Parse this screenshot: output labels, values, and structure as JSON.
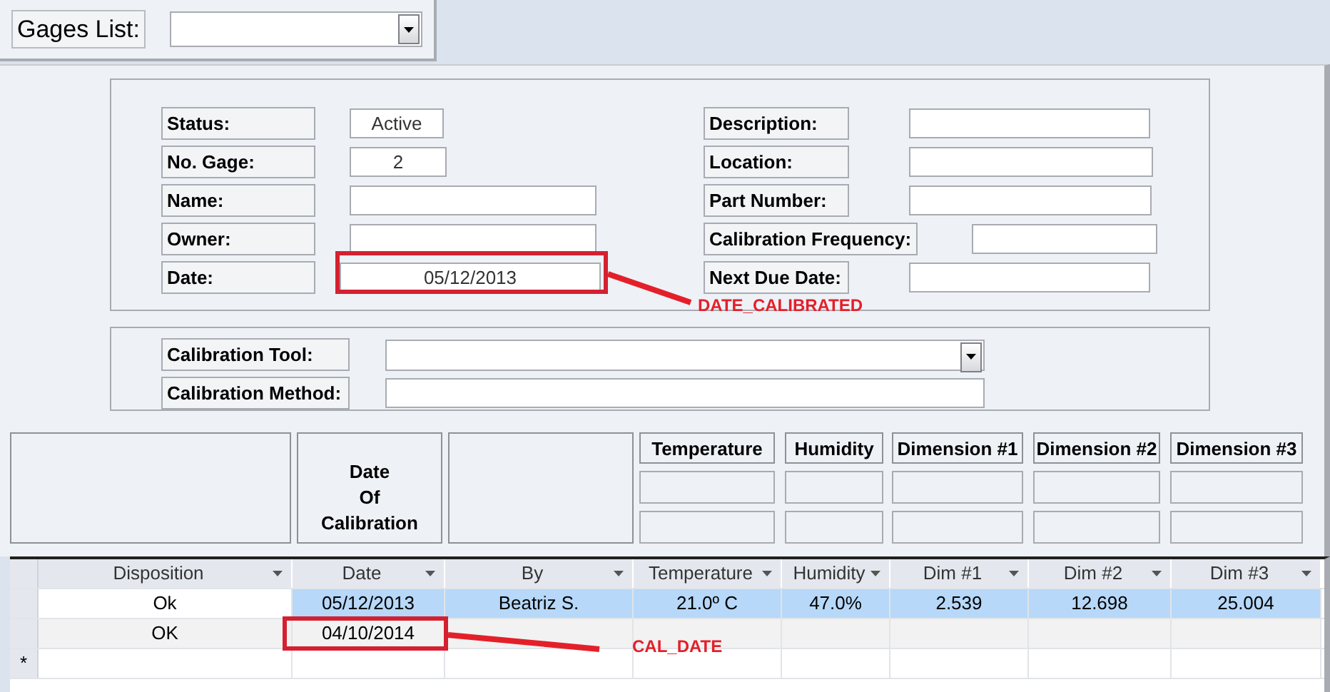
{
  "gages_list": {
    "label": "Gages List:"
  },
  "details": {
    "left": [
      {
        "label": "Status:",
        "value": "Active"
      },
      {
        "label": "No. Gage:",
        "value": "2"
      },
      {
        "label": "Name:"
      },
      {
        "label": "Owner:"
      },
      {
        "label": "Date:",
        "value": "05/12/2013"
      }
    ],
    "right": [
      {
        "label": "Description:"
      },
      {
        "label": "Location:"
      },
      {
        "label": "Part Number:"
      },
      {
        "label": "Calibration Frequency:"
      },
      {
        "label": "Next Due Date:"
      }
    ]
  },
  "calibration": [
    {
      "label": "Calibration Tool:",
      "kind": "combo"
    },
    {
      "label": "Calibration Method:",
      "kind": "text"
    }
  ],
  "header": {
    "date_label": [
      "Date",
      "Of",
      "Calibration"
    ],
    "measures": [
      "Temperature",
      "Humidity",
      "Dimension #1",
      "Dimension #2",
      "Dimension #3"
    ]
  },
  "table": {
    "columns": [
      "Disposition",
      "Date",
      "By",
      "Temperature",
      "Humidity",
      "Dim #1",
      "Dim #2",
      "Dim #3"
    ],
    "rows": [
      {
        "selected": true,
        "cells": [
          "Ok",
          "05/12/2013",
          "Beatriz S.",
          "21.0º C",
          "47.0%",
          "2.539",
          "12.698",
          "25.004"
        ]
      },
      {
        "selected": false,
        "cells": [
          "OK",
          "04/10/2014"
        ]
      }
    ],
    "new_row_marker": "*"
  },
  "annotations": [
    {
      "label": "DATE_CALIBRATED"
    },
    {
      "label": "CAL_DATE"
    }
  ]
}
